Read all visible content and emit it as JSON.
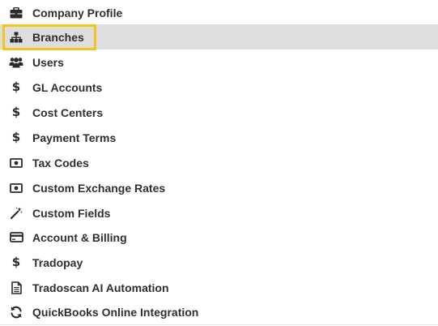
{
  "colors": {
    "active_background": "#dedede",
    "highlight_border": "#f5c518",
    "text": "#2f2f2f",
    "icon": "#2b2b2b"
  },
  "menu": {
    "items": [
      {
        "label": "Company Profile",
        "icon": "briefcase-icon",
        "active": false
      },
      {
        "label": "Branches",
        "icon": "sitemap-icon",
        "active": true
      },
      {
        "label": "Users",
        "icon": "users-icon",
        "active": false
      },
      {
        "label": "GL Accounts",
        "icon": "dollar-icon",
        "active": false
      },
      {
        "label": "Cost Centers",
        "icon": "dollar-icon",
        "active": false
      },
      {
        "label": "Payment Terms",
        "icon": "dollar-icon",
        "active": false
      },
      {
        "label": "Tax Codes",
        "icon": "money-bill-icon",
        "active": false
      },
      {
        "label": "Custom Exchange Rates",
        "icon": "money-bill-icon",
        "active": false
      },
      {
        "label": "Custom Fields",
        "icon": "magic-wand-icon",
        "active": false
      },
      {
        "label": "Account & Billing",
        "icon": "credit-card-icon",
        "active": false
      },
      {
        "label": "Tradopay",
        "icon": "dollar-icon",
        "active": false
      },
      {
        "label": "Tradoscan AI Automation",
        "icon": "document-icon",
        "active": false
      },
      {
        "label": "QuickBooks Online Integration",
        "icon": "sync-icon",
        "active": false
      }
    ]
  }
}
